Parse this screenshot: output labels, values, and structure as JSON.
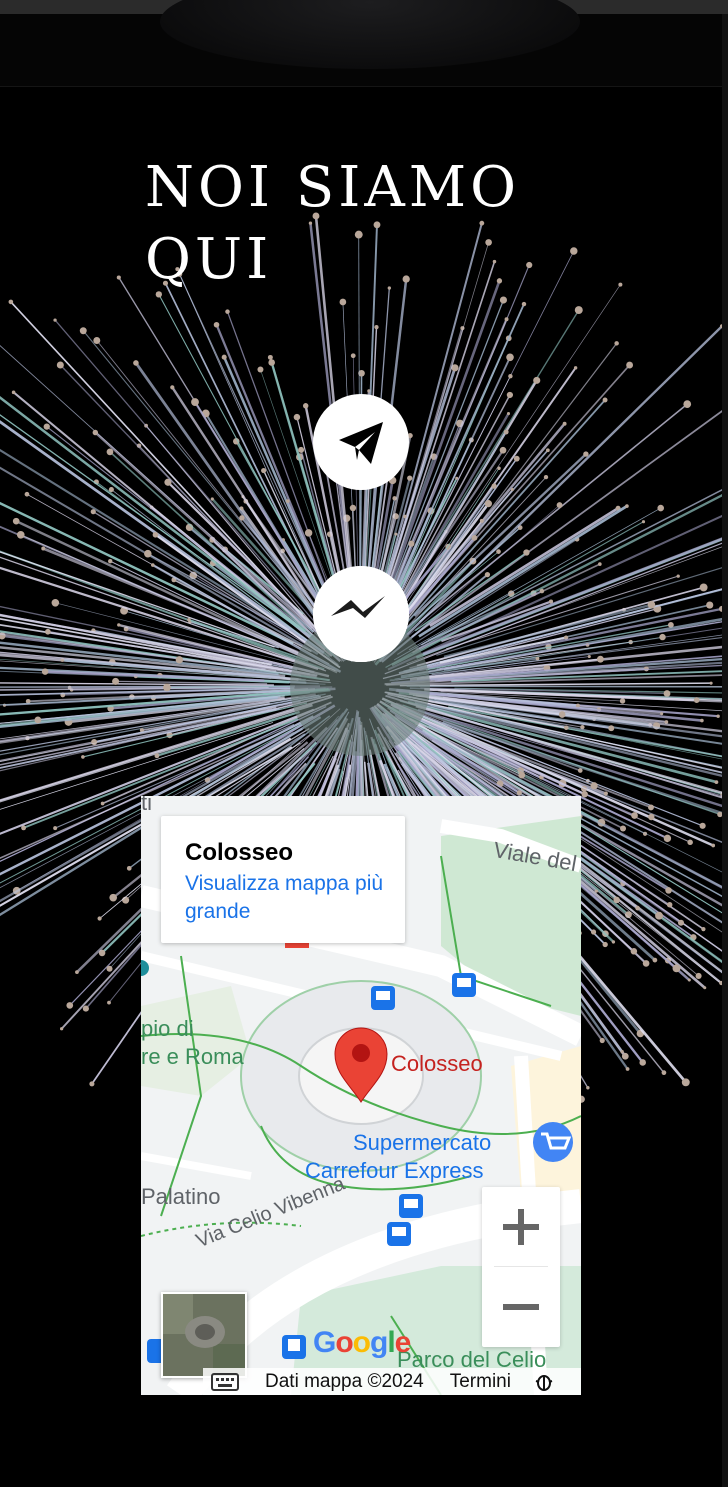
{
  "section": {
    "title": "NOI SIAMO QUI"
  },
  "social": {
    "telegram_icon": "telegram-icon",
    "messenger_icon": "messenger-icon"
  },
  "map": {
    "place_title": "Colosseo",
    "larger_map_link": "Visualizza mappa più grande",
    "marker_label": "Colosseo",
    "labels": {
      "viale": "Viale del",
      "venere1": "pio di",
      "venere2": "re e Roma",
      "supermarket1": "Supermercato",
      "supermarket2": "Carrefour Express",
      "palatino": "Palatino",
      "via_celio": "Via Celio Vibenna",
      "parco": "Parco del Celio",
      "ti": "ti"
    },
    "zoom_in": "+",
    "zoom_out": "−",
    "google": "Google",
    "attribution": {
      "keyboard_icon": "keyboard-icon",
      "data": "Dati mappa ©2024",
      "terms": "Termini",
      "report_icon": "bug-report-icon"
    },
    "colors": {
      "marker": "#ea4335",
      "link": "#1a73e8",
      "park": "#3a8e5a",
      "transit": "#1a73e8"
    }
  }
}
